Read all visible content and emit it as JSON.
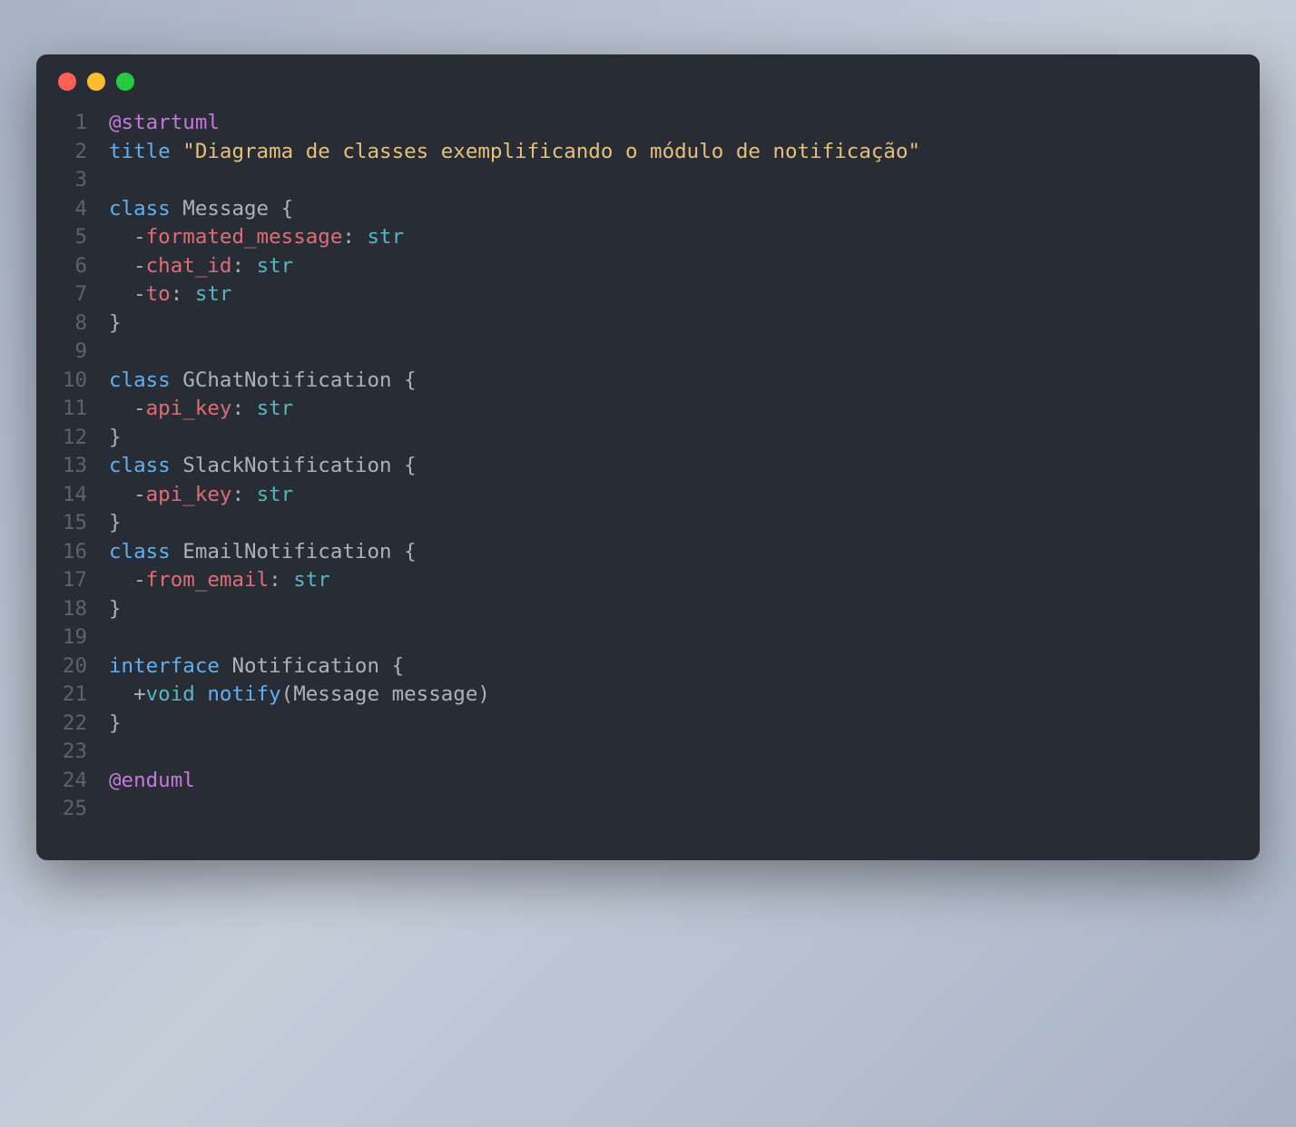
{
  "window": {
    "traffic_lights": [
      "red",
      "yellow",
      "green"
    ]
  },
  "code": {
    "lines": [
      {
        "num": "1",
        "tokens": [
          {
            "t": "@startuml",
            "c": "tk-purple"
          }
        ]
      },
      {
        "num": "2",
        "tokens": [
          {
            "t": "title",
            "c": "tk-blue"
          },
          {
            "t": " ",
            "c": "tk-punc"
          },
          {
            "t": "\"Diagrama de classes exemplificando o módulo de notificação\"",
            "c": "tk-white"
          }
        ]
      },
      {
        "num": "3",
        "tokens": []
      },
      {
        "num": "4",
        "tokens": [
          {
            "t": "class",
            "c": "tk-blue"
          },
          {
            "t": " ",
            "c": "tk-punc"
          },
          {
            "t": "Message",
            "c": "tk-ident"
          },
          {
            "t": " {",
            "c": "tk-punc"
          }
        ]
      },
      {
        "num": "5",
        "tokens": [
          {
            "t": "  -",
            "c": "tk-punc"
          },
          {
            "t": "formated_message",
            "c": "tk-red"
          },
          {
            "t": ": ",
            "c": "tk-punc"
          },
          {
            "t": "str",
            "c": "tk-teal"
          }
        ]
      },
      {
        "num": "6",
        "tokens": [
          {
            "t": "  -",
            "c": "tk-punc"
          },
          {
            "t": "chat_id",
            "c": "tk-red"
          },
          {
            "t": ": ",
            "c": "tk-punc"
          },
          {
            "t": "str",
            "c": "tk-teal"
          }
        ]
      },
      {
        "num": "7",
        "tokens": [
          {
            "t": "  -",
            "c": "tk-punc"
          },
          {
            "t": "to",
            "c": "tk-red"
          },
          {
            "t": ": ",
            "c": "tk-punc"
          },
          {
            "t": "str",
            "c": "tk-teal"
          }
        ]
      },
      {
        "num": "8",
        "tokens": [
          {
            "t": "}",
            "c": "tk-punc"
          }
        ]
      },
      {
        "num": "9",
        "tokens": []
      },
      {
        "num": "10",
        "tokens": [
          {
            "t": "class",
            "c": "tk-blue"
          },
          {
            "t": " ",
            "c": "tk-punc"
          },
          {
            "t": "GChatNotification",
            "c": "tk-ident"
          },
          {
            "t": " {",
            "c": "tk-punc"
          }
        ]
      },
      {
        "num": "11",
        "tokens": [
          {
            "t": "  -",
            "c": "tk-punc"
          },
          {
            "t": "api_key",
            "c": "tk-red"
          },
          {
            "t": ": ",
            "c": "tk-punc"
          },
          {
            "t": "str",
            "c": "tk-teal"
          }
        ]
      },
      {
        "num": "12",
        "tokens": [
          {
            "t": "}",
            "c": "tk-punc"
          }
        ]
      },
      {
        "num": "13",
        "tokens": [
          {
            "t": "class",
            "c": "tk-blue"
          },
          {
            "t": " ",
            "c": "tk-punc"
          },
          {
            "t": "SlackNotification",
            "c": "tk-ident"
          },
          {
            "t": " {",
            "c": "tk-punc"
          }
        ]
      },
      {
        "num": "14",
        "tokens": [
          {
            "t": "  -",
            "c": "tk-punc"
          },
          {
            "t": "api_key",
            "c": "tk-red"
          },
          {
            "t": ": ",
            "c": "tk-punc"
          },
          {
            "t": "str",
            "c": "tk-teal"
          }
        ]
      },
      {
        "num": "15",
        "tokens": [
          {
            "t": "}",
            "c": "tk-punc"
          }
        ]
      },
      {
        "num": "16",
        "tokens": [
          {
            "t": "class",
            "c": "tk-blue"
          },
          {
            "t": " ",
            "c": "tk-punc"
          },
          {
            "t": "EmailNotification",
            "c": "tk-ident"
          },
          {
            "t": " {",
            "c": "tk-punc"
          }
        ]
      },
      {
        "num": "17",
        "tokens": [
          {
            "t": "  -",
            "c": "tk-punc"
          },
          {
            "t": "from_email",
            "c": "tk-red"
          },
          {
            "t": ": ",
            "c": "tk-punc"
          },
          {
            "t": "str",
            "c": "tk-teal"
          }
        ]
      },
      {
        "num": "18",
        "tokens": [
          {
            "t": "}",
            "c": "tk-punc"
          }
        ]
      },
      {
        "num": "19",
        "tokens": []
      },
      {
        "num": "20",
        "tokens": [
          {
            "t": "interface",
            "c": "tk-blue"
          },
          {
            "t": " ",
            "c": "tk-punc"
          },
          {
            "t": "Notification",
            "c": "tk-ident"
          },
          {
            "t": " {",
            "c": "tk-punc"
          }
        ]
      },
      {
        "num": "21",
        "tokens": [
          {
            "t": "  +",
            "c": "tk-punc"
          },
          {
            "t": "void",
            "c": "tk-teal"
          },
          {
            "t": " ",
            "c": "tk-punc"
          },
          {
            "t": "notify",
            "c": "tk-blue"
          },
          {
            "t": "(",
            "c": "tk-punc"
          },
          {
            "t": "Message message",
            "c": "tk-ident"
          },
          {
            "t": ")",
            "c": "tk-punc"
          }
        ]
      },
      {
        "num": "22",
        "tokens": [
          {
            "t": "}",
            "c": "tk-punc"
          }
        ]
      },
      {
        "num": "23",
        "tokens": []
      },
      {
        "num": "24",
        "tokens": [
          {
            "t": "@enduml",
            "c": "tk-purple"
          }
        ]
      },
      {
        "num": "25",
        "tokens": []
      }
    ]
  }
}
